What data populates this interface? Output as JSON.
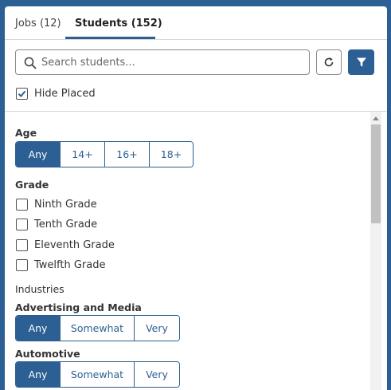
{
  "tabs": {
    "jobs": "Jobs (12)",
    "students": "Students (152)"
  },
  "search": {
    "placeholder": "Search students...",
    "value": ""
  },
  "icons": {
    "search": "search-icon",
    "refresh": "refresh-icon",
    "filter": "filter-icon",
    "check": "check-icon",
    "scroll_up": "chevron-up-icon"
  },
  "hide_placed": {
    "label": "Hide Placed",
    "checked": true
  },
  "age": {
    "title": "Age",
    "options": [
      "Any",
      "14+",
      "16+",
      "18+"
    ],
    "selected": "Any"
  },
  "grade": {
    "title": "Grade",
    "options": [
      "Ninth Grade",
      "Tenth Grade",
      "Eleventh Grade",
      "Twelfth Grade"
    ]
  },
  "industries": {
    "title": "Industries",
    "items": [
      {
        "title": "Advertising and Media",
        "options": [
          "Any",
          "Somewhat",
          "Very"
        ],
        "selected": "Any"
      },
      {
        "title": "Automotive",
        "options": [
          "Any",
          "Somewhat",
          "Very"
        ],
        "selected": "Any"
      }
    ]
  },
  "colors": {
    "accent": "#2c5f93",
    "border": "#8a8a8a",
    "divider": "#d6d6d6"
  }
}
